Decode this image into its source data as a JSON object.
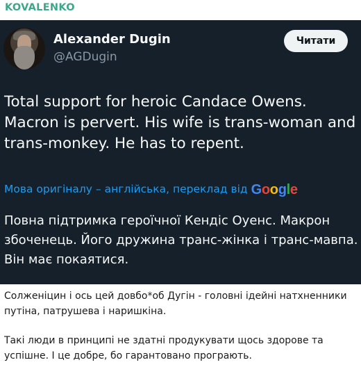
{
  "channel": {
    "name": "KOVALENKO"
  },
  "tweet": {
    "author_name": "Alexander Dugin",
    "author_handle": "@AGDugin",
    "read_button_label": "Читати",
    "text": "Total support for heroic Candace Owens. Macron is pervert. His wife is trans-woman and trans-monkey. He has to repent.",
    "translation_notice": "Мова оригіналу – англійська, переклад від",
    "translation_provider": "Google",
    "translated_text": "Повна підтримка героїчної Кендіс Оуенс. Макрон збоченець. Його дружина транс-жінка і транс-мавпа. Він має покаятися."
  },
  "post": {
    "paragraph_1": "Солженіцин і ось цей довбо*об Дугін - головні ідейні натхненники путіна, патрушева і наришкіна.",
    "paragraph_2": "Такі люди в принципі не здатні продукувати щось здорове та успішне. І це добре, бо гарантовано програють."
  },
  "colors": {
    "channel_accent": "#3ea68a",
    "card_background": "#15202b",
    "link_blue": "#1d9bf0",
    "google_blue": "#4285f4",
    "google_red": "#ea4335",
    "google_yellow": "#fbbc05",
    "google_green": "#34a853"
  }
}
